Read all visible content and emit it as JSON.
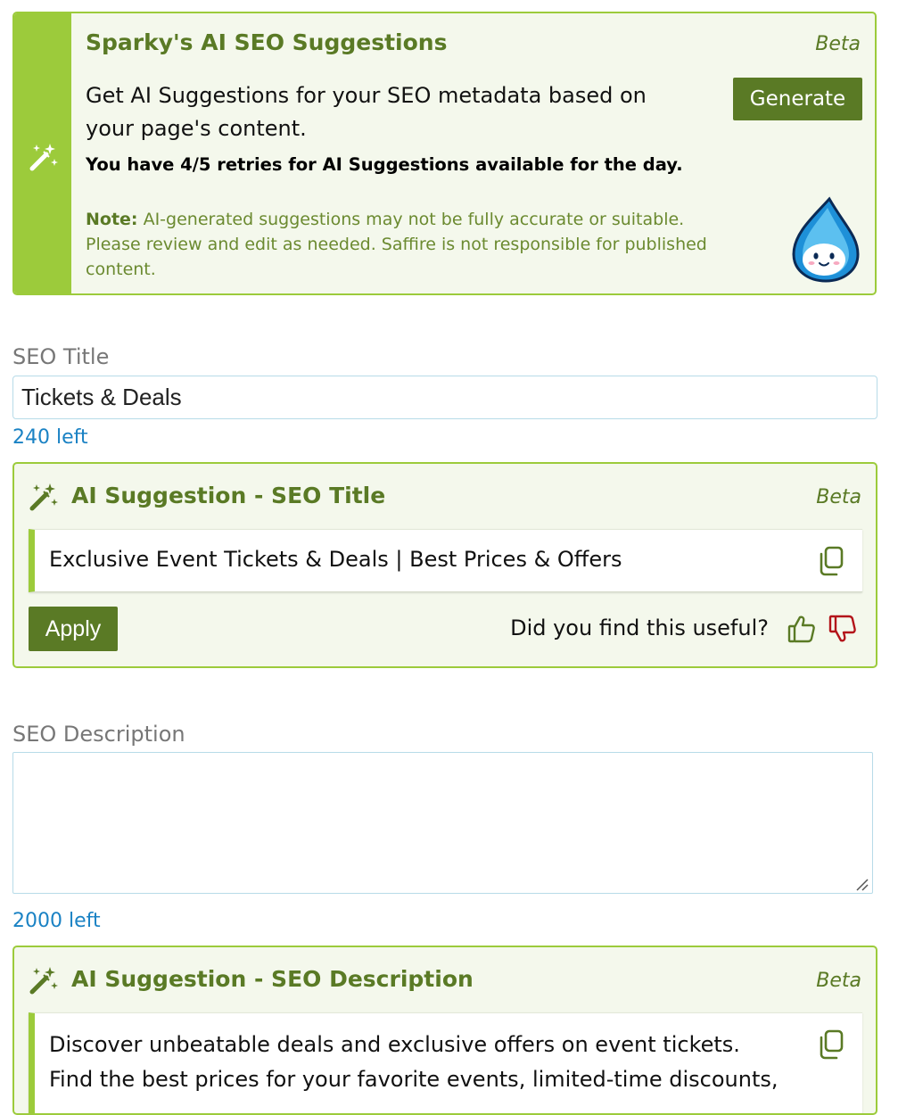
{
  "sparky": {
    "title": "Sparky's AI SEO Suggestions",
    "beta": "Beta",
    "description": "Get AI Suggestions for your SEO metadata based on your page's content.",
    "generate_label": "Generate",
    "retries": "You have 4/5 retries for AI Suggestions available for the day.",
    "note_label": "Note:",
    "note_text": " AI-generated suggestions may not be fully accurate or suitable. Please review and edit as needed. Saffire is not responsible for published content."
  },
  "seo_title": {
    "label": "SEO Title",
    "value": "Tickets & Deals",
    "counter": "240 left"
  },
  "title_suggestion": {
    "heading": "AI Suggestion - SEO Title",
    "beta": "Beta",
    "text": "Exclusive Event Tickets & Deals | Best Prices & Offers",
    "apply_label": "Apply",
    "feedback_question": "Did you find this useful?"
  },
  "seo_description": {
    "label": "SEO Description",
    "value": "",
    "counter": "2000 left"
  },
  "description_suggestion": {
    "heading": "AI Suggestion - SEO Description",
    "beta": "Beta",
    "text": "Discover unbeatable deals and exclusive offers on event tickets. Find the best prices for your favorite events, limited-time discounts,"
  },
  "colors": {
    "accent_green": "#9ccb3b",
    "dark_green": "#5a7a25",
    "panel_bg": "#f4f8ec",
    "link_blue": "#1a82c4",
    "thumbs_down_red": "#b3141a"
  },
  "icons": [
    "magic-wand-icon",
    "copy-icon",
    "thumbs-up-icon",
    "thumbs-down-icon",
    "mascot-drop-icon",
    "resize-grip-icon"
  ]
}
